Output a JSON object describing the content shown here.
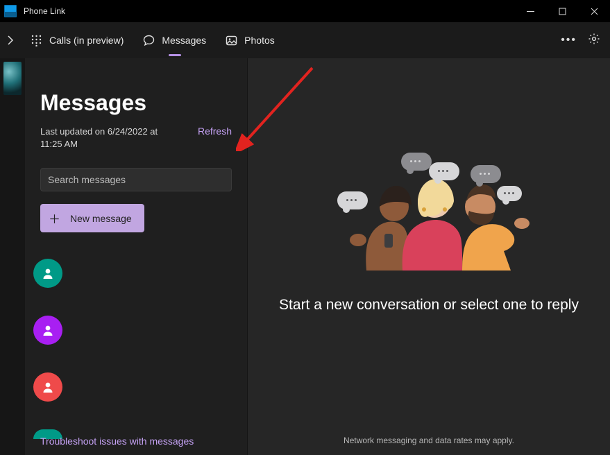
{
  "app": {
    "title": "Phone Link"
  },
  "nav": {
    "calls": "Calls (in preview)",
    "messages": "Messages",
    "photos": "Photos"
  },
  "sidebar": {
    "heading": "Messages",
    "last_updated": "Last updated on 6/24/2022 at 11:25 AM",
    "refresh": "Refresh",
    "search_placeholder": "Search messages",
    "new_message": "New message",
    "conversations": [
      {
        "avatar_color": "teal"
      },
      {
        "avatar_color": "purple"
      },
      {
        "avatar_color": "red"
      },
      {
        "avatar_color": "teal-partial"
      }
    ],
    "troubleshoot": "Troubleshoot issues with messages"
  },
  "content": {
    "prompt": "Start a new conversation or select one to reply",
    "disclaimer": "Network messaging and data rates may apply."
  }
}
